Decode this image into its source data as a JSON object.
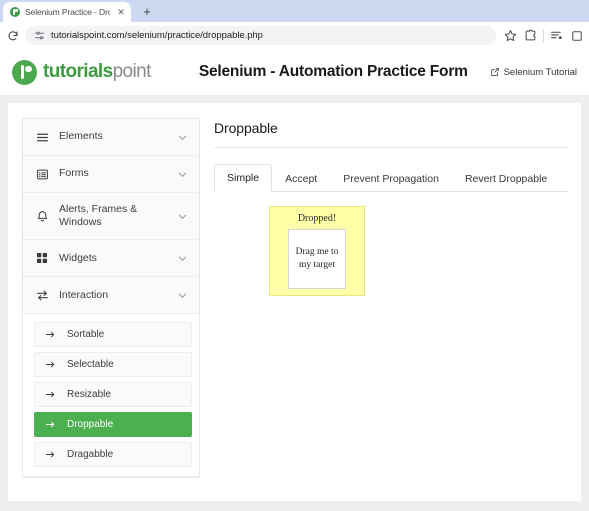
{
  "browser": {
    "tab": {
      "title": "Selenium Practice - Droppabl",
      "favicon": "tutorialspoint-favicon",
      "close_label": "✕"
    },
    "new_tab_label": "+",
    "toolbar": {
      "reload_icon": "reload-icon",
      "site_settings_icon": "site-settings-icon",
      "url": "tutorialspoint.com/selenium/practice/droppable.php",
      "bookmark_icon": "star-icon",
      "extensions_icon": "extensions-puzzle-icon",
      "split_view_icon": "tab-list-icon",
      "profile_icon": "profile-icon"
    }
  },
  "site_header": {
    "logo_primary": "tutorials",
    "logo_secondary": "point",
    "page_title": "Selenium - Automation Practice Form",
    "tutorial_link": "Selenium Tutorial",
    "tutorial_link_icon": "external-link-icon"
  },
  "sidebar": {
    "groups": [
      {
        "label": "Elements",
        "icon": "hamburger-icon",
        "expanded": false
      },
      {
        "label": "Forms",
        "icon": "list-box-icon",
        "expanded": false
      },
      {
        "label": "Alerts, Frames & Windows",
        "icon": "bell-icon",
        "expanded": false
      },
      {
        "label": "Widgets",
        "icon": "grid-icon",
        "expanded": false
      },
      {
        "label": "Interaction",
        "icon": "swap-arrows-icon",
        "expanded": true
      }
    ],
    "submenu": [
      {
        "label": "Sortable",
        "active": false
      },
      {
        "label": "Selectable",
        "active": false
      },
      {
        "label": "Resizable",
        "active": false
      },
      {
        "label": "Droppable",
        "active": true
      },
      {
        "label": "Dragabble",
        "active": false
      }
    ],
    "active_color": "#4caf50"
  },
  "main": {
    "title": "Droppable",
    "tabs": [
      {
        "label": "Simple",
        "active": true
      },
      {
        "label": "Accept",
        "active": false
      },
      {
        "label": "Prevent Propagation",
        "active": false
      },
      {
        "label": "Revert Droppable",
        "active": false
      }
    ],
    "droppable": {
      "status_text": "Dropped!",
      "draggable_text": "Drag me to my target",
      "zone_color": "#ffffa8"
    }
  }
}
